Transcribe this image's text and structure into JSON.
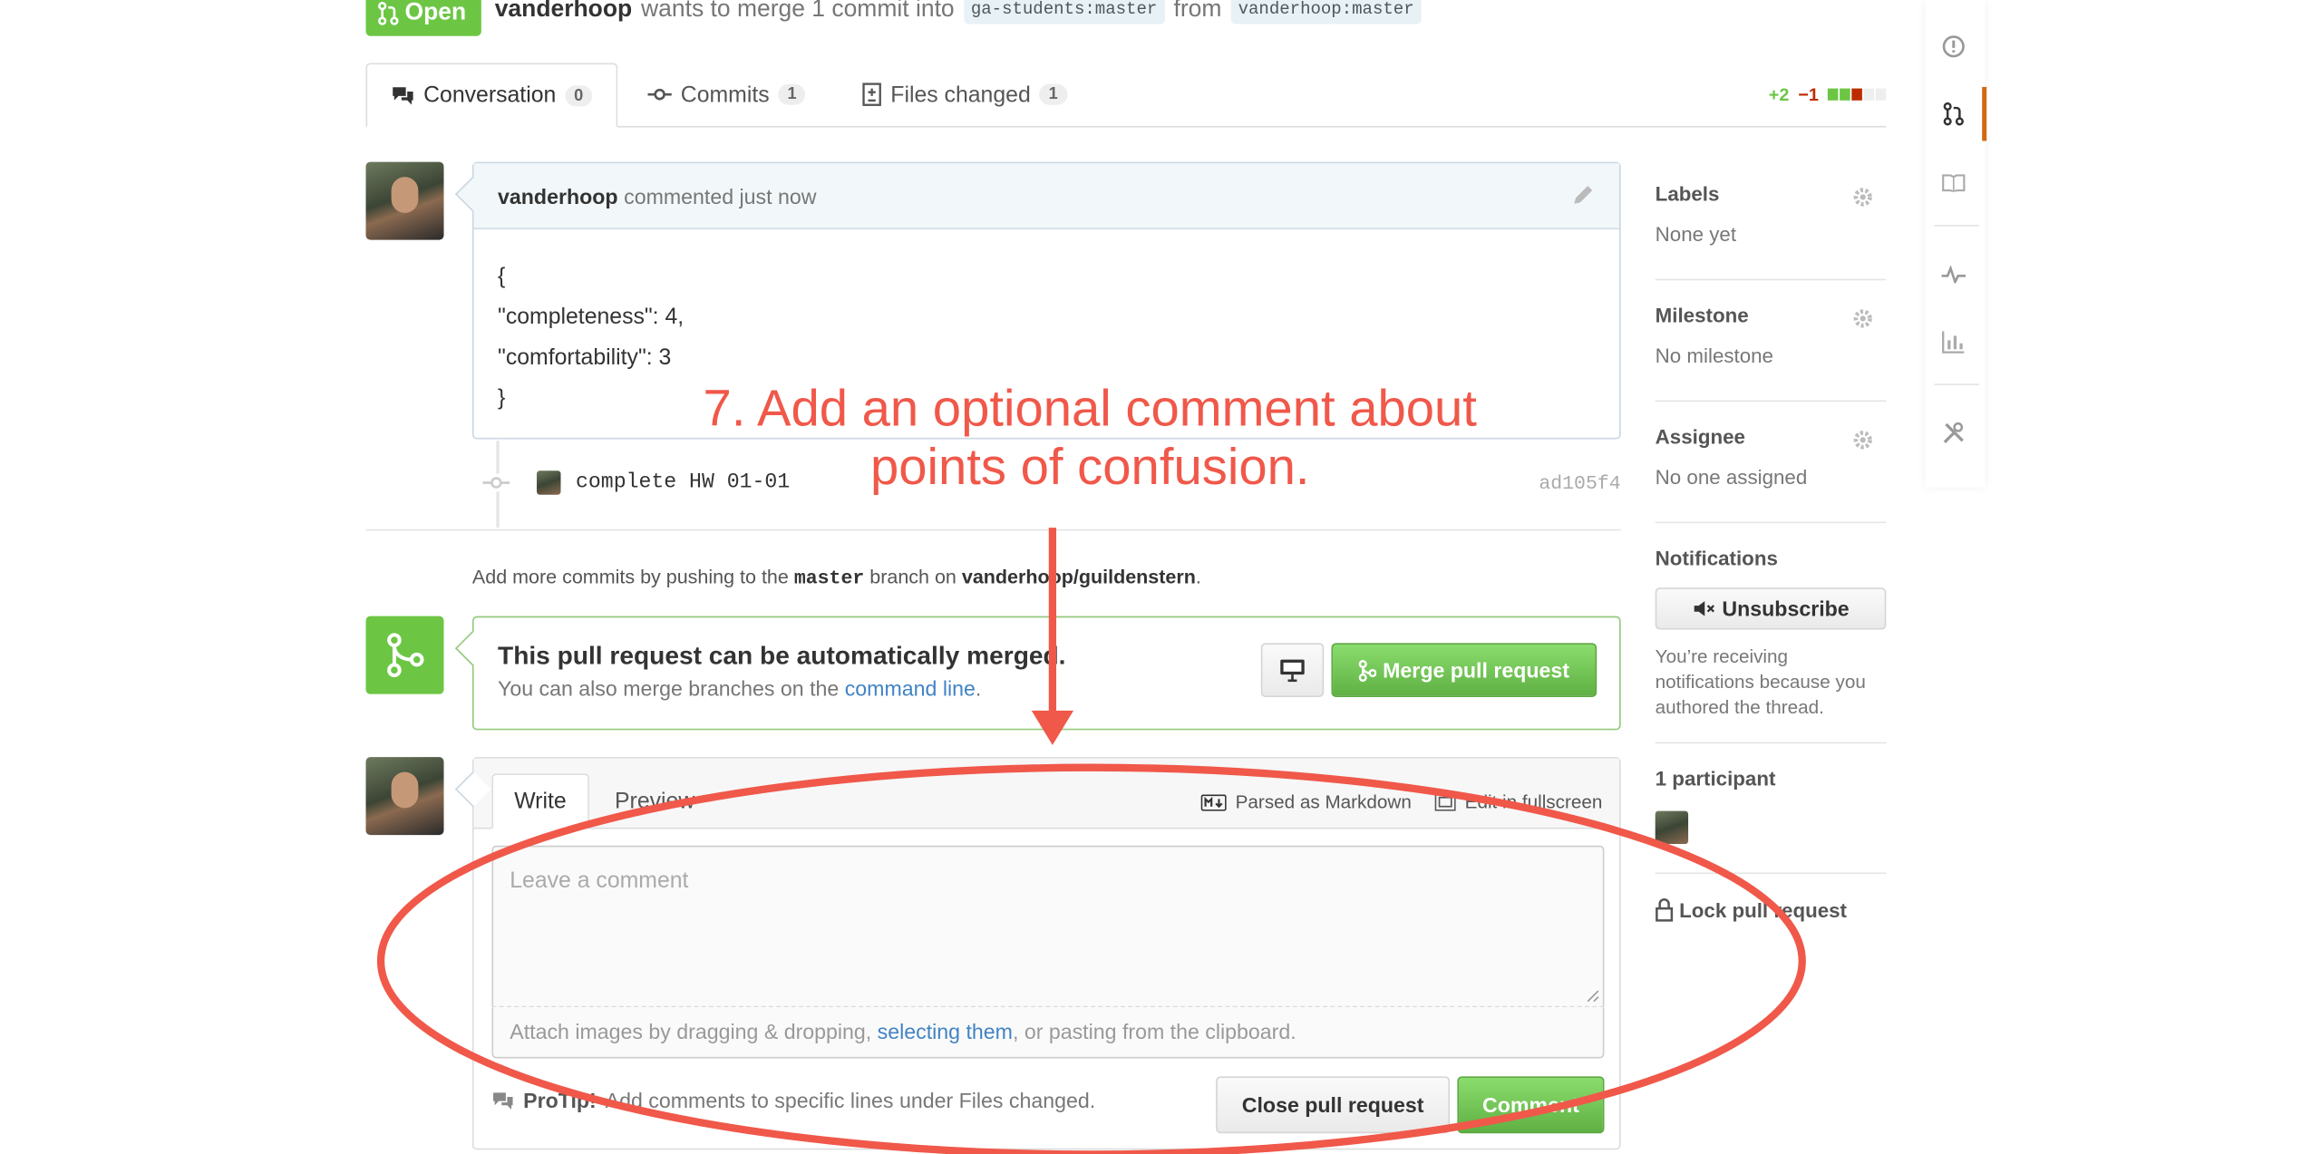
{
  "header": {
    "state_label": "Open",
    "author": "vanderhoop",
    "action_text": "wants to merge 1 commit into",
    "base_owner": "ga-students",
    "base_branch": "master",
    "from_text": "from",
    "head_owner": "vanderhoop",
    "head_branch": "master"
  },
  "tabs": [
    {
      "label": "Conversation",
      "count": "0",
      "icon": "comment-discussion-icon"
    },
    {
      "label": "Commits",
      "count": "1",
      "icon": "git-commit-icon"
    },
    {
      "label": "Files changed",
      "count": "1",
      "icon": "diff-icon"
    }
  ],
  "diffstat": {
    "additions": "+2",
    "deletions": "−1",
    "colors": {
      "add": "#6cc644",
      "del": "#bd2c00",
      "neutral": "#eeeeee"
    }
  },
  "comment": {
    "author": "vanderhoop",
    "meta": "commented just now",
    "body_lines": [
      "{",
      "\"completeness\": 4,",
      "\"comfortability\": 3",
      "}"
    ]
  },
  "commit": {
    "message": "complete HW 01-01",
    "sha": "ad105f4"
  },
  "push_hint": {
    "prefix": "Add more commits by pushing to the",
    "branch": "master",
    "middle": "branch on",
    "repo": "vanderhoop/guildenstern",
    "suffix": "."
  },
  "merge": {
    "title": "This pull request can be automatically merged.",
    "subtitle_prefix": "You can also merge branches on the",
    "subtitle_link": "command line",
    "subtitle_suffix": ".",
    "merge_button": "Merge pull request"
  },
  "composer": {
    "tab_write": "Write",
    "tab_preview": "Preview",
    "markdown_hint": "Parsed as Markdown",
    "fullscreen_hint": "Edit in fullscreen",
    "placeholder": "Leave a comment",
    "attach_prefix": "Attach images by dragging & dropping,",
    "attach_link": "selecting them",
    "attach_suffix": ", or pasting from the clipboard.",
    "protip_label": "ProTip!",
    "protip_text": "Add comments to specific lines under Files changed.",
    "close_button": "Close pull request",
    "comment_button": "Comment"
  },
  "sidebar": {
    "labels_title": "Labels",
    "labels_value": "None yet",
    "milestone_title": "Milestone",
    "milestone_value": "No milestone",
    "assignee_title": "Assignee",
    "assignee_value": "No one assigned",
    "notifications_title": "Notifications",
    "unsubscribe_button": "Unsubscribe",
    "notifications_text": "You’re receiving notifications because you authored the thread.",
    "participants_title": "1 participant",
    "lock_label": "Lock pull request"
  },
  "annotation": {
    "line1": "7. Add an optional comment about",
    "line2": "points of confusion.",
    "color": "#f0584a"
  },
  "colors": {
    "accent_green": "#6cc644",
    "link_blue": "#4183c4",
    "repo_nav_accent": "#d26911"
  }
}
